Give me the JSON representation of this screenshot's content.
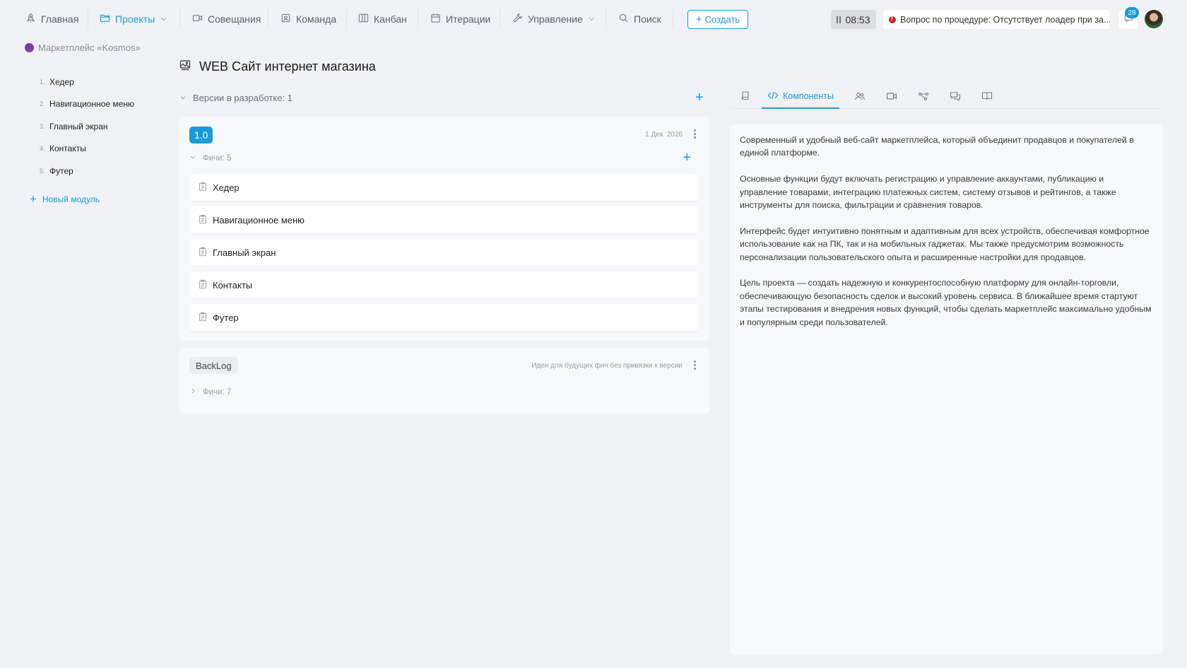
{
  "nav": {
    "home": "Главная",
    "projects": "Проекты",
    "meetings": "Совещания",
    "team": "Команда",
    "kanban": "Канбан",
    "iterations": "Итерации",
    "management": "Управление",
    "search": "Поиск",
    "create": "Создать",
    "timer": "08:53",
    "notice": "Вопрос по процедуре: Отсутствует лоадер при за...",
    "messages_count": "28"
  },
  "sidebar": {
    "project": "Маркетплейс «Kosmos»",
    "modules": [
      {
        "num": "1.",
        "label": "Хедер"
      },
      {
        "num": "2.",
        "label": "Навигационное меню"
      },
      {
        "num": "3.",
        "label": "Главный экран"
      },
      {
        "num": "4.",
        "label": "Контакты"
      },
      {
        "num": "5.",
        "label": "Футер"
      }
    ],
    "new_module": "Новый модуль"
  },
  "page": {
    "title": "WEB Сайт интернет магазина",
    "versions_label": "Версии в разработке: 1"
  },
  "version": {
    "name": "1.0",
    "date": "1 Дек. 2026",
    "features_label": "Фичи: 5",
    "features": [
      "Хедер",
      "Навигационное меню",
      "Главный экран",
      "Контакты",
      "Футер"
    ]
  },
  "backlog": {
    "name": "BackLog",
    "note": "Идеи для будущих фич без привязки к версии",
    "features_label": "Фичи: 7"
  },
  "tabs": {
    "components": "Компоненты"
  },
  "description": [
    "Современный и удобный веб-сайт маркетплейса, который объединит продавцов и покупателей в единой платформе.",
    "Основные функции будут включать регистрацию и управление аккаунтами, публикацию и управление товарами, интеграцию платежных систем, систему отзывов и рейтингов, а также инструменты для поиска, фильтрации и сравнения товаров.",
    "Интерфейс будет интуитивно понятным и адаптивным для всех устройств, обеспечивая комфортное использование как на ПК, так и на мобильных гаджетах. Мы также предусмотрим возможность персонализации пользовательского опыта и расширенные настройки для продавцов.",
    "Цель проекта — создать надежную и конкурентоспособную платформу для онлайн-торговли, обеспечивающую безопасность сделок и высокий уровень сервиса. В ближайшее время стартуют этапы тестирования и внедрения новых функций, чтобы сделать маркетплейс максимально удобным и популярным среди пользователей."
  ],
  "colors": {
    "accent": "#1a9ad6",
    "background": "#f0f1f4",
    "card": "#f7f8fa",
    "alert": "#c62828",
    "project_dot": "#7b3fa0"
  },
  "icons": {
    "home": "rocket-icon",
    "projects": "folder-icon",
    "meetings": "camera-icon",
    "team": "badge-icon",
    "kanban": "columns-icon",
    "iterations": "calendar-icon",
    "management": "wrench-icon",
    "search": "search-icon"
  }
}
